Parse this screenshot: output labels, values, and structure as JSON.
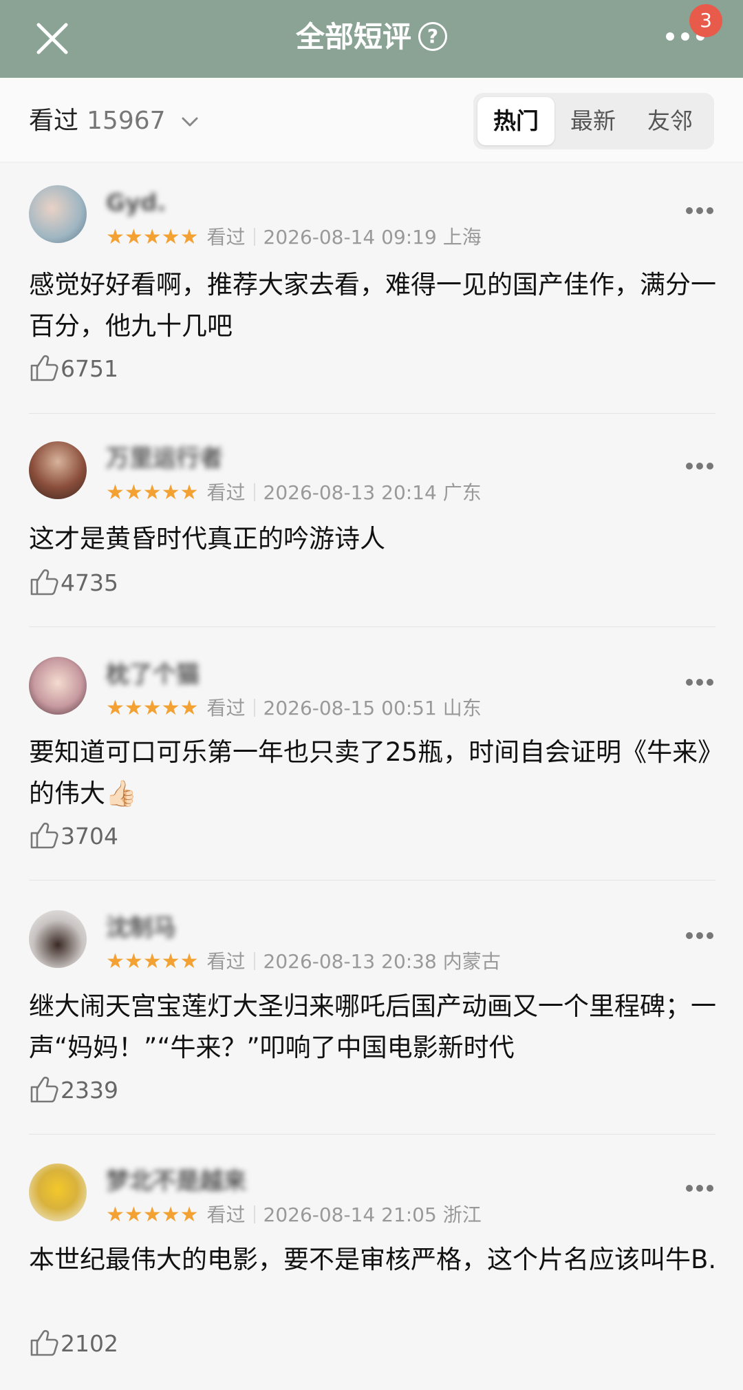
{
  "header": {
    "title": "全部短评",
    "help_glyph": "?",
    "badge_count": "3",
    "background_color": "#8aa394"
  },
  "filter": {
    "watched_label": "看过",
    "watched_count": "15967",
    "tabs": [
      {
        "label": "热门",
        "active": true
      },
      {
        "label": "最新",
        "active": false
      },
      {
        "label": "友邻",
        "active": false
      }
    ]
  },
  "reviews": [
    {
      "username": "Gyd.",
      "stars": "★★★★★",
      "status": "看过",
      "datetime": "2026-08-14 09:19",
      "location": "上海",
      "text": "感觉好好看啊，推荐大家去看，难得一见的国产佳作，满分一百分，他九十几吧",
      "likes": "6751"
    },
    {
      "username": "万里运行者",
      "stars": "★★★★★",
      "status": "看过",
      "datetime": "2026-08-13 20:14",
      "location": "广东",
      "text": "这才是黄昏时代真正的吟游诗人",
      "likes": "4735"
    },
    {
      "username": "枕了个猫",
      "stars": "★★★★★",
      "status": "看过",
      "datetime": "2026-08-15 00:51",
      "location": "山东",
      "text": "要知道可口可乐第一年也只卖了25瓶，时间自会证明《牛来》的伟大👍🏻",
      "likes": "3704"
    },
    {
      "username": "沈制马",
      "stars": "★★★★★",
      "status": "看过",
      "datetime": "2026-08-13 20:38",
      "location": "内蒙古",
      "text": "继大闹天宫宝莲灯大圣归来哪吒后国产动画又一个里程碑；一声“妈妈！”“牛来？”叩响了中国电影新时代",
      "likes": "2339"
    },
    {
      "username": "梦北不是越来",
      "stars": "★★★★★",
      "status": "看过",
      "datetime": "2026-08-14 21:05",
      "location": "浙江",
      "text": "本世纪最伟大的电影，要不是审核严格，这个片名应该叫牛B.",
      "likes": "2102"
    }
  ],
  "colors": {
    "star": "#f4a133",
    "badge": "#e85b4a"
  }
}
